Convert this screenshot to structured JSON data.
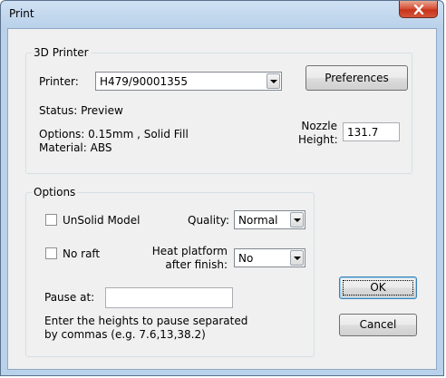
{
  "window": {
    "title": "Print"
  },
  "printer_group": {
    "legend": "3D Printer",
    "printer_label": "Printer:",
    "printer_value": "H479/90001355",
    "preferences_label": "Preferences",
    "status_text": "Status: Preview",
    "options_text": "Options: 0.15mm , Solid Fill",
    "material_text": "Material: ABS",
    "nozzle_label_1": "Nozzle",
    "nozzle_label_2": "Height:",
    "nozzle_value": "131.7"
  },
  "options_group": {
    "legend": "Options",
    "unsolid_label": "UnSolid Model",
    "unsolid_checked": false,
    "quality_label": "Quality:",
    "quality_value": "Normal",
    "noraft_label": "No raft",
    "noraft_checked": false,
    "heat_label_1": "Heat platform",
    "heat_label_2": "after finish:",
    "heat_value": "No",
    "pause_label": "Pause at:",
    "pause_value": "",
    "hint_line_1": "Enter the heights to pause separated",
    "hint_line_2": "by commas (e.g. 7.6,13,38.2)"
  },
  "buttons": {
    "ok_label": "OK",
    "cancel_label": "Cancel"
  },
  "icons": {
    "close": "close-icon",
    "dropdown": "chevron-down-icon"
  }
}
